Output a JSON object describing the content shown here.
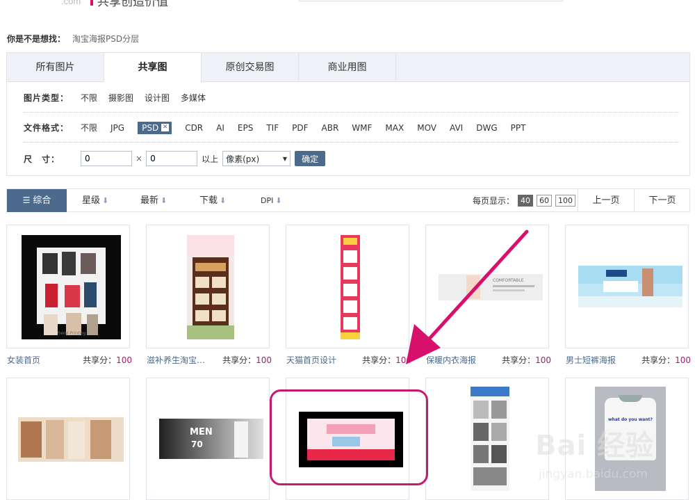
{
  "header": {
    "logo_tail": ".com",
    "slogan": "共享创造价值"
  },
  "suggest": {
    "label": "你是不是想找：",
    "link": "淘宝海报PSD分层"
  },
  "tabs": [
    {
      "label": "所有图片"
    },
    {
      "label": "共享图"
    },
    {
      "label": "原创交易图"
    },
    {
      "label": "商业用图"
    }
  ],
  "filters": {
    "type_label": "图片类型：",
    "types": [
      "不限",
      "摄影图",
      "设计图",
      "多媒体"
    ],
    "format_label": "文件格式：",
    "formats": [
      "不限",
      "JPG",
      "PSD",
      "CDR",
      "AI",
      "EPS",
      "TIF",
      "PDF",
      "ABR",
      "WMF",
      "MAX",
      "MOV",
      "AVI",
      "DWG",
      "PPT"
    ],
    "size_label": "尺　寸：",
    "width_value": "0",
    "height_value": "0",
    "times": "×",
    "above": "以上",
    "unit": "像素(px)",
    "confirm": "确定"
  },
  "sort": {
    "items": [
      "综合",
      "星级",
      "最新",
      "下载",
      "DPI"
    ],
    "per_page_label": "每页显示：",
    "per_page": [
      "40",
      "60",
      "100"
    ],
    "prev": "上一页",
    "next": "下一页"
  },
  "cards": [
    {
      "title": "女装首页",
      "share_label": "共享分：",
      "score": "100"
    },
    {
      "title": "滋补养生淘宝…",
      "share_label": "共享分：",
      "score": "100"
    },
    {
      "title": "天猫首页设计",
      "share_label": "共享分：",
      "score": "100"
    },
    {
      "title": "保暖内衣海报",
      "share_label": "共享分：",
      "score": "100"
    },
    {
      "title": "男士短裤海报",
      "share_label": "共享分：",
      "score": "100"
    }
  ],
  "thumbs": {
    "promo_text": "COMFORTABLE",
    "men_text": "MEN",
    "men_number": "70",
    "tshirt_text": "what do you want?",
    "dress_text": "Trend Printing"
  },
  "watermark": {
    "main": "Bai 经验",
    "sub": "jingyan.baidu.com"
  },
  "colors": {
    "accent": "#4c6a8c",
    "highlight": "#c61a6f",
    "score": "#a01e6e"
  }
}
